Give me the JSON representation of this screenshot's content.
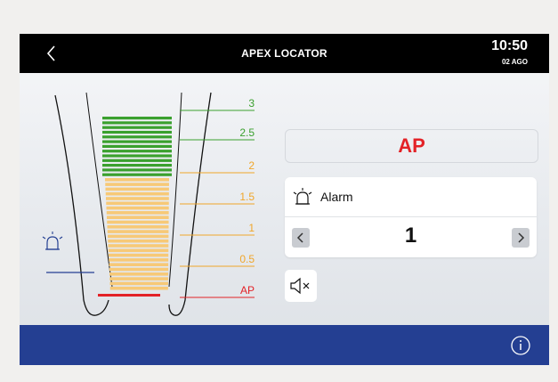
{
  "header": {
    "title": "APEX LOCATOR",
    "time": "10:50",
    "date": "02 AGO"
  },
  "scale": {
    "labels": [
      "3",
      "2.5",
      "2",
      "1.5",
      "1",
      "0.5",
      "AP"
    ],
    "label_colors": [
      "#3aa02e",
      "#3aa02e",
      "#f0a62a",
      "#f0a62a",
      "#f0a62a",
      "#f0a62a",
      "#e32227"
    ]
  },
  "reading": {
    "value": "AP",
    "color": "#e32227"
  },
  "alarm": {
    "label": "Alarm",
    "value": "1"
  },
  "colors": {
    "green": "#3aa02e",
    "orange": "#f0a62a",
    "orange_fill": "#f7c977",
    "red": "#e32227",
    "header": "#000000",
    "footer": "#243f92"
  },
  "icons": {
    "back": "chevron-left-icon",
    "alarm_marker": "alarm-bell-icon",
    "alarm": "alarm-bell-icon",
    "mute": "speaker-muted-icon",
    "info": "info-icon",
    "prev": "chevron-left-icon",
    "next": "chevron-right-icon"
  }
}
